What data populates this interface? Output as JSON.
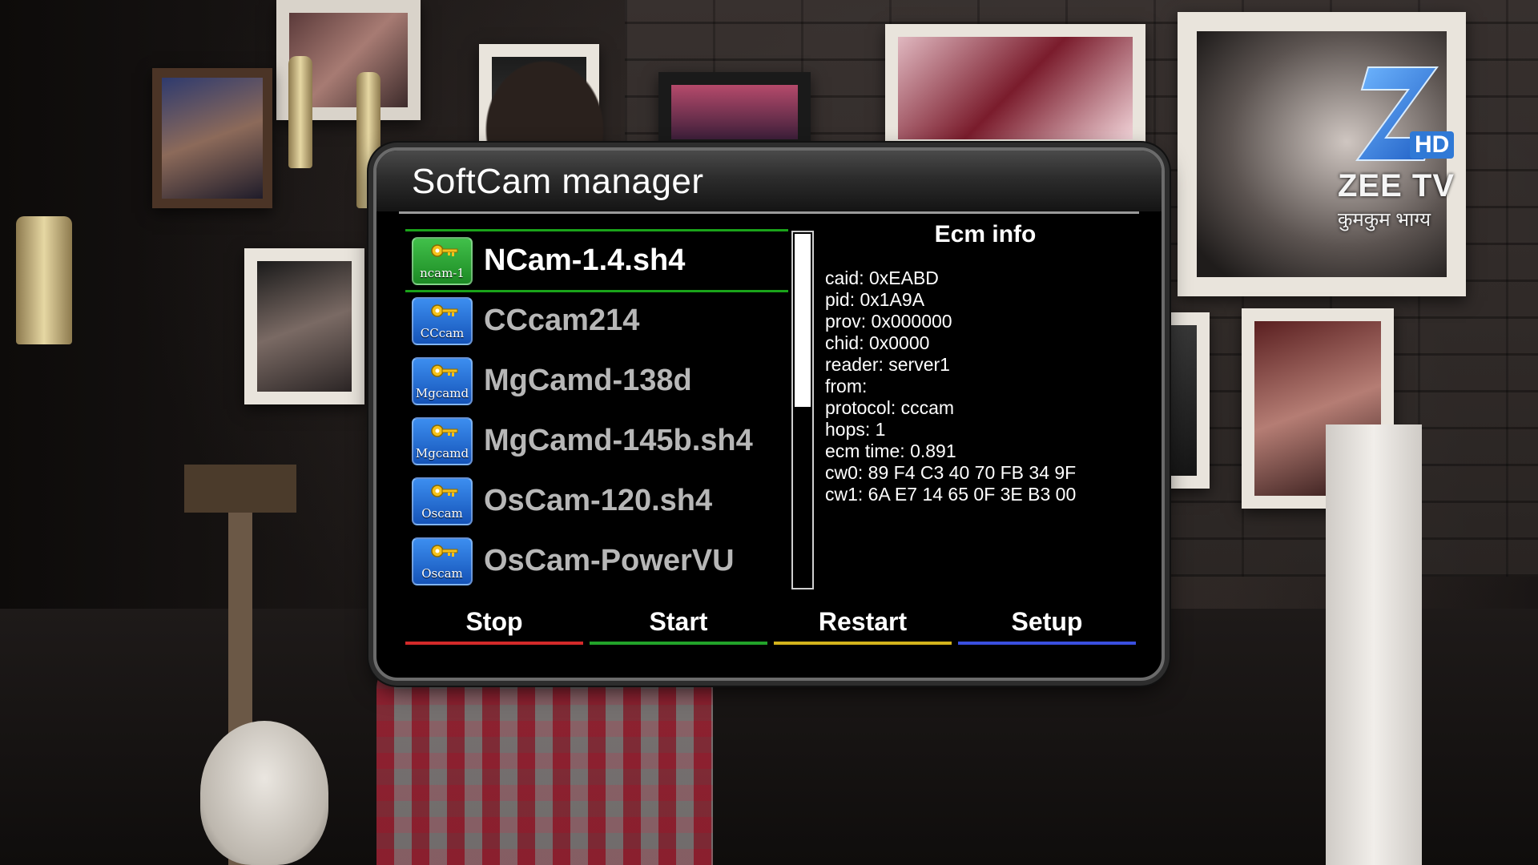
{
  "channel": {
    "logo_text": "ZEE TV",
    "hd_badge": "HD",
    "show_title": "कुमकुम भाग्य",
    "logo_color": "#2f79d6"
  },
  "dialog": {
    "title": "SoftCam manager",
    "selected_index": 0,
    "scroll_fraction": 0.49,
    "items": [
      {
        "label": "NCam-1.4.sh4",
        "icon_text": "ncam-1",
        "icon": "green-key-icon",
        "color": "#2aa332"
      },
      {
        "label": "CCcam214",
        "icon_text": "CCcam",
        "icon": "blue-key-icon",
        "color": "#2a6fd6"
      },
      {
        "label": "MgCamd-138d",
        "icon_text": "Mgcamd",
        "icon": "blue-key-icon",
        "color": "#2a6fd6"
      },
      {
        "label": "MgCamd-145b.sh4",
        "icon_text": "Mgcamd",
        "icon": "blue-key-icon",
        "color": "#2a6fd6"
      },
      {
        "label": "OsCam-120.sh4",
        "icon_text": "Oscam",
        "icon": "blue-key-icon",
        "color": "#2a6fd6"
      },
      {
        "label": "OsCam-PowerVU",
        "icon_text": "Oscam",
        "icon": "blue-key-icon",
        "color": "#2a6fd6"
      }
    ],
    "ecm": {
      "title": "Ecm info",
      "lines": [
        "caid: 0xEABD",
        "pid: 0x1A9A",
        "prov: 0x000000",
        "chid: 0x0000",
        "reader: server1",
        "from:",
        "protocol: cccam",
        "hops: 1",
        "ecm time: 0.891",
        "cw0: 89 F4 C3 40 70 FB 34 9F",
        "cw1: 6A E7 14 65 0F 3E B3 00"
      ]
    },
    "buttons": [
      {
        "label": "Stop",
        "color": "#d42a2a"
      },
      {
        "label": "Start",
        "color": "#22a32a"
      },
      {
        "label": "Restart",
        "color": "#d4b31c"
      },
      {
        "label": "Setup",
        "color": "#3a4fe0"
      }
    ]
  }
}
